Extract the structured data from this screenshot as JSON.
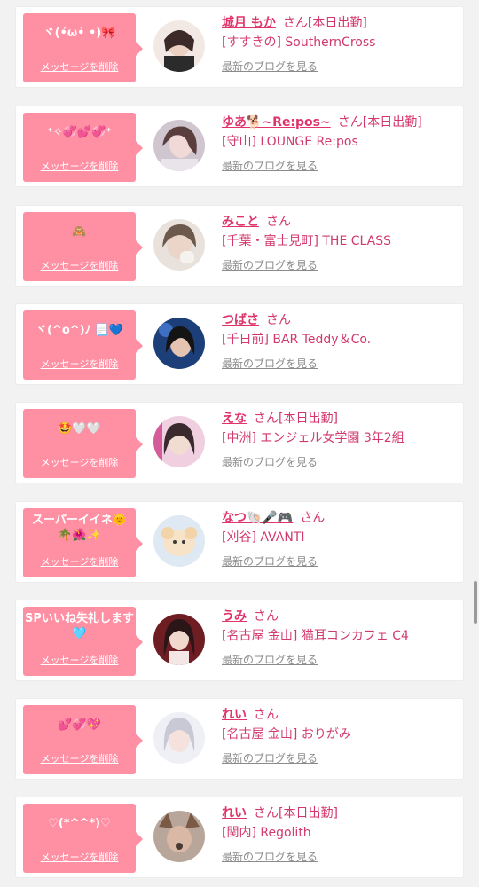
{
  "delete_label": "メッセージを削除",
  "blog_label": "最新のブログを見る",
  "entries": [
    {
      "message": "ヾ(•́ω•̀ •)🎀",
      "name": "城月 もか",
      "honorific": "さん",
      "status": "[本日出勤]",
      "location": "[すすきの] SouthernCross"
    },
    {
      "message": "⁺✧💞💕💞⁺",
      "name": "ゆあ🐕~Re:pos~",
      "honorific": "さん",
      "status": "[本日出勤]",
      "location": "[守山] LOUNGE Re:pos"
    },
    {
      "message": "🙈",
      "name": "みこと",
      "honorific": "さん",
      "status": "",
      "location": "[千葉・富士見町] THE CLASS"
    },
    {
      "message": "ヾ(^o^)ﾉ 📃💙",
      "name": "つばさ",
      "honorific": "さん",
      "status": "",
      "location": "[千日前] BAR Teddy＆Co."
    },
    {
      "message": "🤩🤍🤍",
      "name": "えな",
      "honorific": "さん",
      "status": "[本日出勤]",
      "location": "[中洲] エンジェル女学園 3年2組"
    },
    {
      "message": "スーパーイイネ🌞🌴🌺✨",
      "name": "なつ🐚🎤🎮",
      "honorific": "さん",
      "status": "",
      "location": "[刈谷] AVANTI"
    },
    {
      "message": "SPいいね失礼します🩵",
      "name": "うみ",
      "honorific": "さん",
      "status": "",
      "location": "[名古屋 金山] 猫耳コンカフェ C4"
    },
    {
      "message": "💕💞💖",
      "name": "れい",
      "honorific": "さん",
      "status": "",
      "location": "[名古屋 金山] おりがみ"
    },
    {
      "message": "♡(*^^*)♡",
      "name": "れい",
      "honorific": "さん",
      "status": "[本日出勤]",
      "location": "[関内] Regolith"
    }
  ]
}
